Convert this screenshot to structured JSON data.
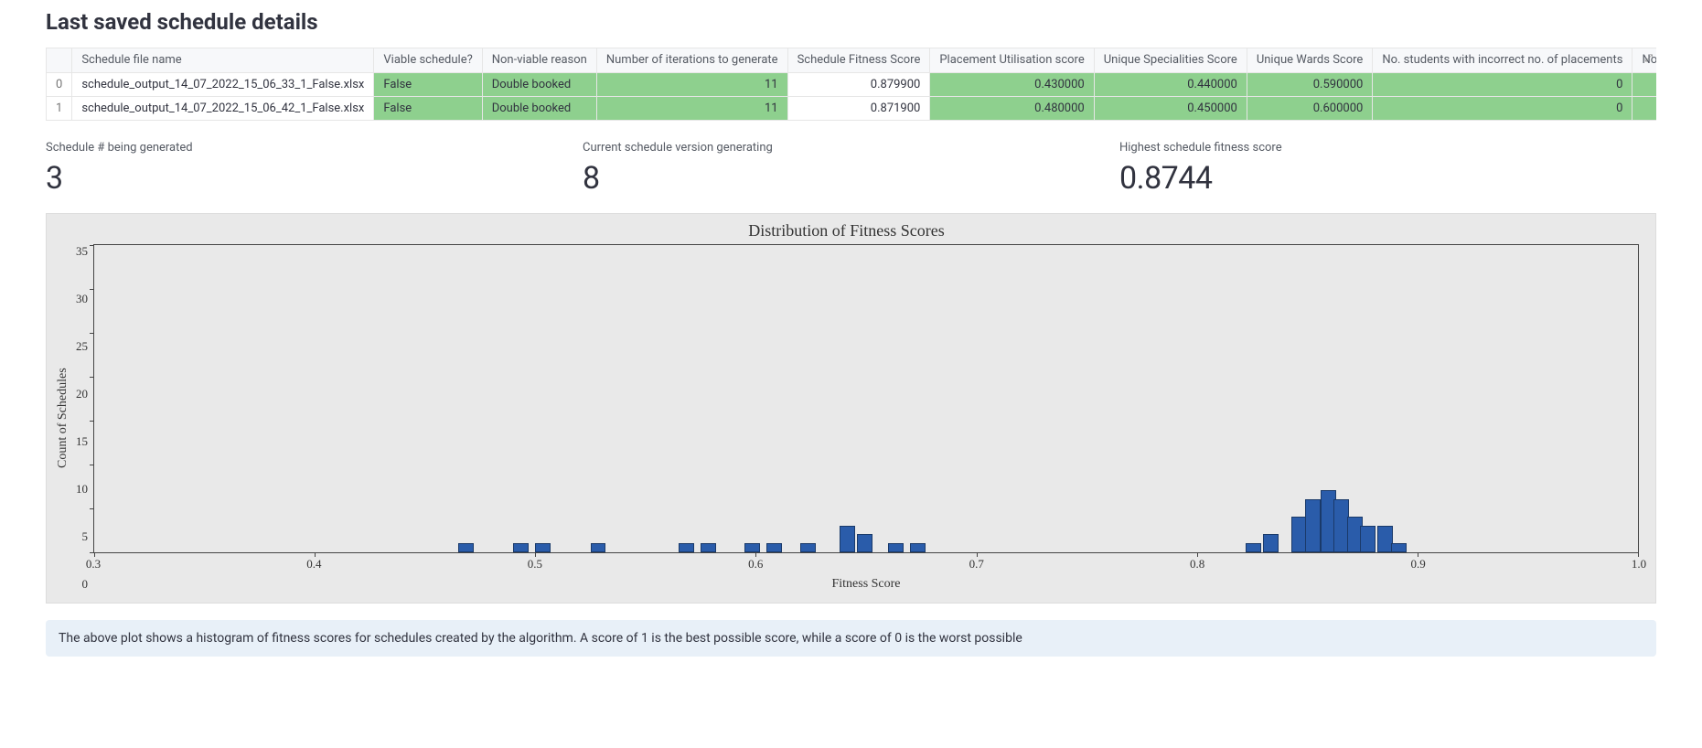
{
  "section_title": "Last saved schedule details",
  "table": {
    "headers": [
      "",
      "Schedule file name",
      "Viable schedule?",
      "Non-viable reason",
      "Number of iterations to generate",
      "Schedule Fitness Score",
      "Placement Utilisation score",
      "Unique Specialities Score",
      "Unique Wards Score",
      "No. students with incorrect no. of placements",
      "No. of placements with the incorrect leng"
    ],
    "rows": [
      {
        "idx": "0",
        "file": "schedule_output_14_07_2022_15_06_33_1_False.xlsx",
        "viable": "False",
        "reason": "Double booked",
        "iterations": "11",
        "fitness": "0.879900",
        "placement": "0.430000",
        "specialities": "0.440000",
        "wards": "0.590000",
        "incorrect_students": "0",
        "incorrect_placements": ""
      },
      {
        "idx": "1",
        "file": "schedule_output_14_07_2022_15_06_42_1_False.xlsx",
        "viable": "False",
        "reason": "Double booked",
        "iterations": "11",
        "fitness": "0.871900",
        "placement": "0.480000",
        "specialities": "0.450000",
        "wards": "0.600000",
        "incorrect_students": "0",
        "incorrect_placements": ""
      }
    ]
  },
  "metrics": {
    "schedule_num_label": "Schedule # being generated",
    "schedule_num_value": "3",
    "current_version_label": "Current schedule version generating",
    "current_version_value": "8",
    "highest_fitness_label": "Highest schedule fitness score",
    "highest_fitness_value": "0.8744"
  },
  "chart_data": {
    "type": "bar",
    "title": "Distribution of Fitness Scores",
    "xlabel": "Fitness Score",
    "ylabel": "Count of Schedules",
    "xlim": [
      0.3,
      1.0
    ],
    "ylim": [
      0,
      35
    ],
    "x_ticks": [
      "0.3",
      "0.4",
      "0.5",
      "0.6",
      "0.7",
      "0.8",
      "0.9",
      "1.0"
    ],
    "y_ticks": [
      "35",
      "30",
      "25",
      "20",
      "15",
      "10",
      "5",
      "0"
    ],
    "bin_width": 0.007,
    "bars": [
      {
        "x": 0.465,
        "count": 1
      },
      {
        "x": 0.49,
        "count": 1
      },
      {
        "x": 0.5,
        "count": 1
      },
      {
        "x": 0.525,
        "count": 1
      },
      {
        "x": 0.565,
        "count": 1
      },
      {
        "x": 0.575,
        "count": 1
      },
      {
        "x": 0.595,
        "count": 1
      },
      {
        "x": 0.605,
        "count": 1
      },
      {
        "x": 0.62,
        "count": 1
      },
      {
        "x": 0.638,
        "count": 3
      },
      {
        "x": 0.646,
        "count": 2
      },
      {
        "x": 0.66,
        "count": 1
      },
      {
        "x": 0.67,
        "count": 1
      },
      {
        "x": 0.822,
        "count": 1
      },
      {
        "x": 0.83,
        "count": 2
      },
      {
        "x": 0.843,
        "count": 4
      },
      {
        "x": 0.849,
        "count": 6
      },
      {
        "x": 0.856,
        "count": 7
      },
      {
        "x": 0.862,
        "count": 6
      },
      {
        "x": 0.868,
        "count": 4
      },
      {
        "x": 0.874,
        "count": 3
      },
      {
        "x": 0.882,
        "count": 3
      },
      {
        "x": 0.888,
        "count": 1
      }
    ]
  },
  "info_text": "The above plot shows a histogram of fitness scores for schedules created by the algorithm. A score of 1 is the best possible score, while a score of 0 is the worst possible"
}
